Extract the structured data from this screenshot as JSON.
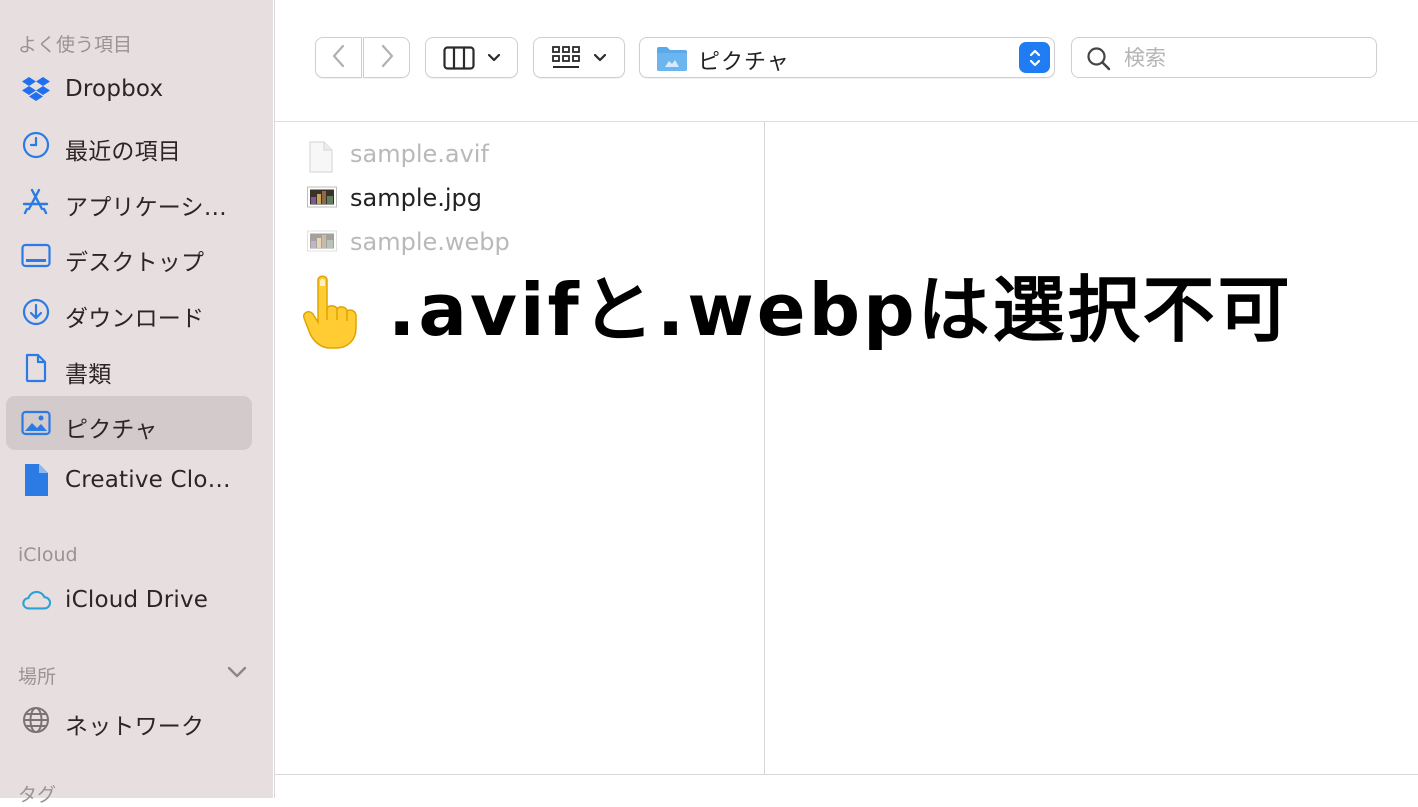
{
  "sidebar": {
    "sections": {
      "favorites": "よく使う項目",
      "icloud": "iCloud",
      "locations": "場所",
      "tags": "タグ"
    },
    "favorites": [
      {
        "label": "Dropbox",
        "icon": "dropbox-icon"
      },
      {
        "label": "最近の項目",
        "icon": "clock-icon"
      },
      {
        "label": "アプリケーシ…",
        "icon": "applications-icon"
      },
      {
        "label": "デスクトップ",
        "icon": "desktop-icon"
      },
      {
        "label": "ダウンロード",
        "icon": "download-icon"
      },
      {
        "label": "書類",
        "icon": "document-icon"
      },
      {
        "label": "ピクチャ",
        "icon": "pictures-icon",
        "active": true
      },
      {
        "label": "Creative Clo…",
        "icon": "file-icon"
      }
    ],
    "icloud_items": [
      {
        "label": "iCloud Drive",
        "icon": "cloud-icon"
      }
    ],
    "location_items": [
      {
        "label": "ネットワーク",
        "icon": "globe-icon"
      }
    ]
  },
  "toolbar": {
    "back": "back",
    "forward": "forward",
    "view_mode": "columns",
    "group_by": "grid",
    "path_label": "ピクチャ",
    "search_placeholder": "検索"
  },
  "files": [
    {
      "name": "sample.avif",
      "enabled": false,
      "icon": "blank-file-icon"
    },
    {
      "name": "sample.jpg",
      "enabled": true,
      "icon": "image-thumbnail-icon"
    },
    {
      "name": "sample.webp",
      "enabled": false,
      "icon": "image-thumbnail-icon"
    }
  ],
  "annotation": {
    "text": ".avifと.webpは選択不可",
    "icon": "pointing-hand-icon"
  },
  "colors": {
    "sidebar_bg": "#e7dfdf",
    "sidebar_active": "#d3cbcb",
    "accent": "#1f7cf2",
    "sidebar_icon": "#2c7be5",
    "disabled_text": "#b9b9b9"
  }
}
